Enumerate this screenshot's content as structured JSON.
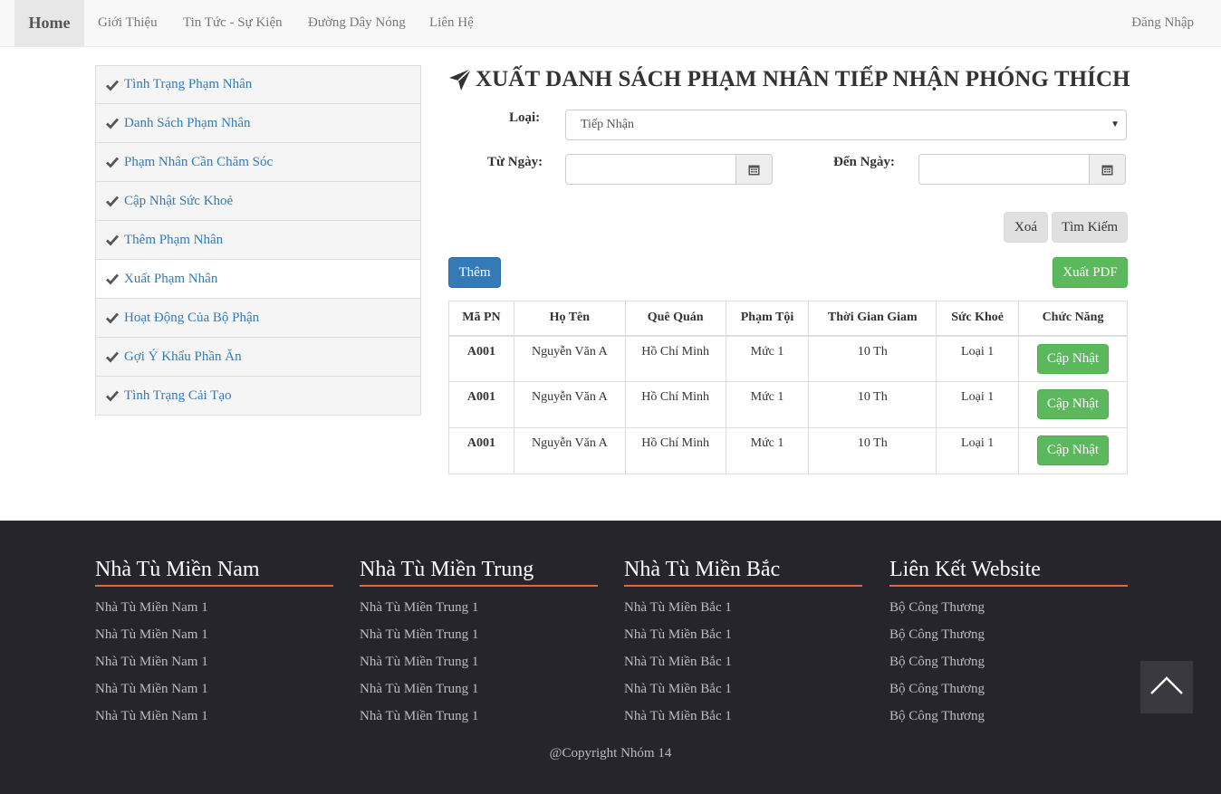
{
  "navbar": {
    "brand": "Home",
    "items": [
      "Giới Thiệu",
      "Tin Tức - Sự Kiện",
      "Đường Dây Nóng",
      "Liên Hệ"
    ],
    "login": "Đăng Nhập"
  },
  "sidebar": {
    "items": [
      {
        "label": "Tình Trạng Phạm Nhân"
      },
      {
        "label": "Danh Sách Phạm Nhân"
      },
      {
        "label": "Phạm Nhân Cần Chăm Sóc"
      },
      {
        "label": "Cập Nhật Sức Khoẻ"
      },
      {
        "label": "Thêm Phạm Nhân"
      },
      {
        "label": "Xuất Phạm Nhân"
      },
      {
        "label": "Hoạt Động Của Bộ Phận"
      },
      {
        "label": "Gợi Ý Khẩu Phần Ăn"
      },
      {
        "label": "Tình Trạng Cải Tạo"
      }
    ],
    "active_index": 5
  },
  "main": {
    "title": "XUẤT DANH SÁCH PHẠM NHÂN TIẾP NHẬN PHÓNG THÍCH",
    "type_label": "Loại:",
    "type_value": "Tiếp Nhận",
    "from_label": "Từ Ngày:",
    "to_label": "Đến Ngày:",
    "from_value": "",
    "to_value": "",
    "clear_button": "Xoá",
    "search_button": "Tìm Kiếm",
    "add_button": "Thêm",
    "export_button": "Xuất PDF",
    "table": {
      "headers": [
        "Mã PN",
        "Họ Tên",
        "Quê Quán",
        "Phạm Tội",
        "Thời Gian Giam",
        "Sức Khoẻ",
        "Chức Năng"
      ],
      "rows": [
        [
          "A001",
          "Nguyễn Văn A",
          "Hồ Chí Minh",
          "Mức 1",
          "10 Th",
          "Loại 1"
        ],
        [
          "A001",
          "Nguyễn Văn A",
          "Hồ Chí Minh",
          "Mức 1",
          "10 Th",
          "Loại 1"
        ],
        [
          "A001",
          "Nguyễn Văn A",
          "Hồ Chí Minh",
          "Mức 1",
          "10 Th",
          "Loại 1"
        ]
      ],
      "row_action": "Cập Nhật"
    }
  },
  "footer": {
    "columns": [
      {
        "title": "Nhà Tù Miền Nam",
        "links": [
          "Nhà Tù Miền Nam 1",
          "Nhà Tù Miền Nam 1",
          "Nhà Tù Miền Nam 1",
          "Nhà Tù Miền Nam 1",
          "Nhà Tù Miền Nam 1"
        ]
      },
      {
        "title": "Nhà Tù Miền Trung",
        "links": [
          "Nhà Tù Miền Trung 1",
          "Nhà Tù Miền Trung 1",
          "Nhà Tù Miền Trung 1",
          "Nhà Tù Miền Trung 1",
          "Nhà Tù Miền Trung 1"
        ]
      },
      {
        "title": "Nhà Tù Miền Bắc",
        "links": [
          "Nhà Tù Miền Bắc 1",
          "Nhà Tù Miền Bắc 1",
          "Nhà Tù Miền Bắc 1",
          "Nhà Tù Miền Bắc 1",
          "Nhà Tù Miền Bắc 1"
        ]
      },
      {
        "title": "Liên Kết Website",
        "links": [
          "Bộ Công Thương",
          "Bộ Công Thương",
          "Bộ Công Thương",
          "Bộ Công Thương",
          "Bộ Công Thương"
        ]
      }
    ],
    "copyright": "@Copyright Nhóm 14"
  },
  "colors": {
    "primary": "#337ab7",
    "success": "#5cb85c",
    "footer_bg": "#26252b",
    "footer_accent": "#e4683f"
  }
}
